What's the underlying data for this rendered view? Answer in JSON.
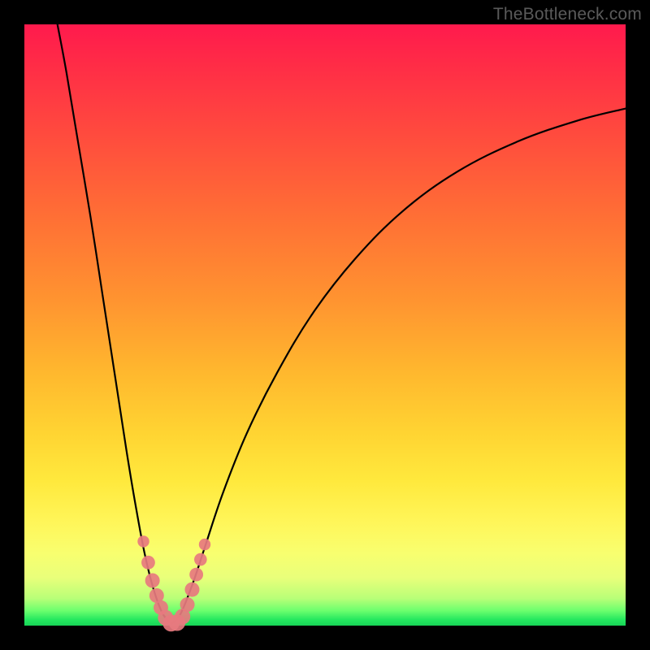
{
  "watermark": "TheBottleneck.com",
  "chart_data": {
    "type": "line",
    "title": "",
    "xlabel": "",
    "ylabel": "",
    "xlim": [
      0,
      100
    ],
    "ylim": [
      0,
      100
    ],
    "grid": false,
    "legend": false,
    "note": "No axes or tick labels are rendered in the image; numeric values are estimated from pixel positions on a 0–100 normalized scale where y is bottleneck percentage (0 at bottom, 100 at top).",
    "series": [
      {
        "name": "left-branch",
        "stroke": "#000000",
        "values": [
          {
            "x": 5.5,
            "y": 100.0
          },
          {
            "x": 7.0,
            "y": 92.0
          },
          {
            "x": 9.0,
            "y": 80.0
          },
          {
            "x": 11.0,
            "y": 68.0
          },
          {
            "x": 13.0,
            "y": 55.0
          },
          {
            "x": 15.0,
            "y": 42.0
          },
          {
            "x": 17.0,
            "y": 29.0
          },
          {
            "x": 18.5,
            "y": 20.0
          },
          {
            "x": 20.0,
            "y": 12.0
          },
          {
            "x": 21.5,
            "y": 6.0
          },
          {
            "x": 23.0,
            "y": 2.0
          },
          {
            "x": 24.5,
            "y": 0.3
          }
        ]
      },
      {
        "name": "right-branch",
        "stroke": "#000000",
        "values": [
          {
            "x": 24.5,
            "y": 0.3
          },
          {
            "x": 26.0,
            "y": 2.0
          },
          {
            "x": 28.0,
            "y": 7.0
          },
          {
            "x": 30.0,
            "y": 13.0
          },
          {
            "x": 33.0,
            "y": 22.0
          },
          {
            "x": 37.0,
            "y": 32.0
          },
          {
            "x": 42.0,
            "y": 42.0
          },
          {
            "x": 48.0,
            "y": 52.0
          },
          {
            "x": 55.0,
            "y": 61.0
          },
          {
            "x": 63.0,
            "y": 69.0
          },
          {
            "x": 72.0,
            "y": 75.5
          },
          {
            "x": 82.0,
            "y": 80.5
          },
          {
            "x": 92.0,
            "y": 84.0
          },
          {
            "x": 100.0,
            "y": 86.0
          }
        ]
      }
    ],
    "markers": {
      "name": "data-points",
      "color": "#e77a7f",
      "note": "Pink dot cluster near the V trough; y values in 0–15% band",
      "points": [
        {
          "x": 19.8,
          "y": 14.0,
          "r": 1.2
        },
        {
          "x": 20.6,
          "y": 10.5,
          "r": 1.4
        },
        {
          "x": 21.3,
          "y": 7.5,
          "r": 1.5
        },
        {
          "x": 22.0,
          "y": 5.0,
          "r": 1.5
        },
        {
          "x": 22.7,
          "y": 3.0,
          "r": 1.5
        },
        {
          "x": 23.5,
          "y": 1.3,
          "r": 1.6
        },
        {
          "x": 24.4,
          "y": 0.4,
          "r": 1.7
        },
        {
          "x": 25.4,
          "y": 0.5,
          "r": 1.7
        },
        {
          "x": 26.3,
          "y": 1.5,
          "r": 1.6
        },
        {
          "x": 27.1,
          "y": 3.5,
          "r": 1.5
        },
        {
          "x": 27.9,
          "y": 6.0,
          "r": 1.5
        },
        {
          "x": 28.6,
          "y": 8.5,
          "r": 1.4
        },
        {
          "x": 29.3,
          "y": 11.0,
          "r": 1.3
        },
        {
          "x": 30.0,
          "y": 13.5,
          "r": 1.2
        }
      ]
    }
  }
}
